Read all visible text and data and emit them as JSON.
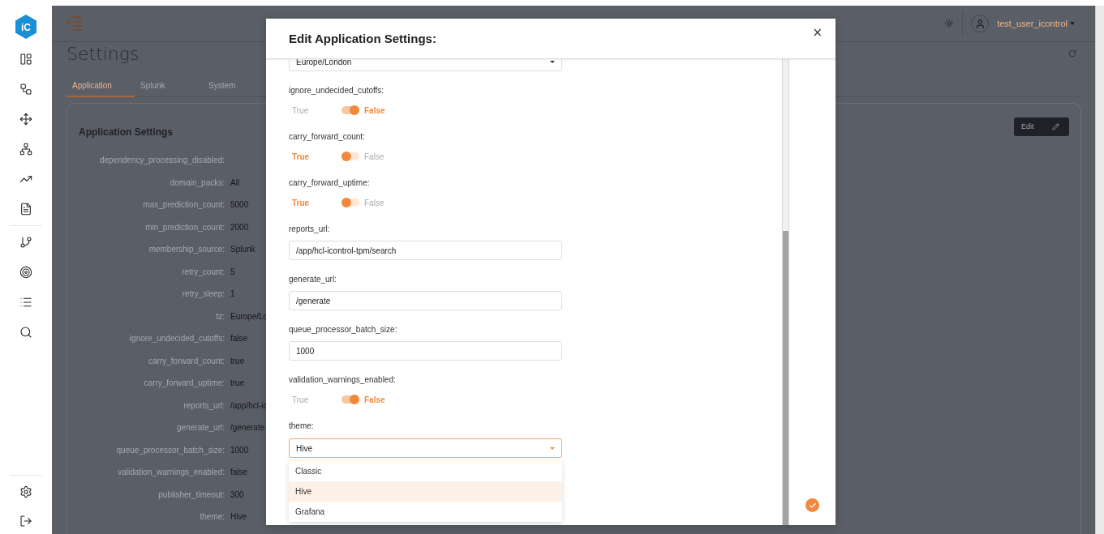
{
  "logo": "iC",
  "header": {
    "user": "test_user_icontrol"
  },
  "page": {
    "title": "Settings",
    "tabs": [
      {
        "label": "Application",
        "selected": true
      },
      {
        "label": "Splunk",
        "selected": false
      },
      {
        "label": "System",
        "selected": false
      }
    ],
    "card": {
      "title": "Application Settings",
      "edit_button": "Edit",
      "rows": [
        {
          "key": "dependency_processing_disabled:"
        },
        {
          "key": "domain_packs:",
          "value": "All"
        },
        {
          "key": "max_prediction_count:",
          "value": "5000"
        },
        {
          "key": "min_prediction_count:",
          "value": "2000"
        },
        {
          "key": "membership_source:",
          "value": "Splunk"
        },
        {
          "key": "retry_count:",
          "value": "5"
        },
        {
          "key": "retry_sleep:",
          "value": "1"
        },
        {
          "key": "tz:",
          "value": "Europe/Lo"
        },
        {
          "key": "ignore_undecided_cutoffs:",
          "value": "false"
        },
        {
          "key": "carry_forward_count:",
          "value": "true"
        },
        {
          "key": "carry_forward_uptime:",
          "value": "true"
        },
        {
          "key": "reports_url:",
          "value": "/app/hcl-ic"
        },
        {
          "key": "generate_url:",
          "value": "/generate"
        },
        {
          "key": "queue_processor_batch_size:",
          "value": "1000"
        },
        {
          "key": "validation_warnings_enabled:",
          "value": "false"
        },
        {
          "key": "publisher_timeout:",
          "value": "300"
        },
        {
          "key": "theme:",
          "value": "Hive"
        }
      ]
    }
  },
  "modal": {
    "title": "Edit Application Settings:",
    "close": "×",
    "fields": [
      {
        "kind": "select",
        "value": "Europe/London",
        "open": false
      },
      {
        "kind": "toggle",
        "label": "ignore_undecided_cutoffs:",
        "true_label": "True",
        "false_label": "False",
        "false_selected": true
      },
      {
        "kind": "toggle",
        "label": "carry_forward_count:",
        "true_label": "True",
        "false_label": "False",
        "false_selected": false
      },
      {
        "kind": "toggle",
        "label": "carry_forward_uptime:",
        "true_label": "True",
        "false_label": "False",
        "false_selected": false
      },
      {
        "kind": "text",
        "label": "reports_url:",
        "value": "/app/hcl-icontrol-tpm/search"
      },
      {
        "kind": "text",
        "label": "generate_url:",
        "value": "/generate"
      },
      {
        "kind": "text",
        "label": "queue_processor_batch_size:",
        "value": "1000"
      },
      {
        "kind": "toggle",
        "label": "validation_warnings_enabled:",
        "true_label": "True",
        "false_label": "False",
        "false_selected": true
      },
      {
        "kind": "select",
        "label": "theme:",
        "value": "Hive",
        "open": true,
        "options": [
          {
            "label": "Classic",
            "selected": false
          },
          {
            "label": "Hive",
            "selected": true
          },
          {
            "label": "Grafana",
            "selected": false
          }
        ]
      }
    ]
  }
}
